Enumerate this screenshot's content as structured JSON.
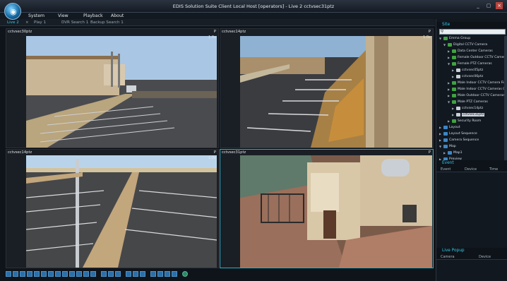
{
  "window": {
    "title": "EDIS Solution Suite Client Local Host [operators] - Live 2  cctvsec31ptz",
    "min_icon": "minimize-icon",
    "max_icon": "maximize-icon",
    "close_icon": "close-icon"
  },
  "menu": [
    "System",
    "View",
    "Playback",
    "About"
  ],
  "tabs": [
    {
      "label": "Live 2",
      "active": true
    },
    {
      "label": "Play 1",
      "active": false
    },
    {
      "label": "DVR Search 1",
      "active": false
    },
    {
      "label": "Backup Search 1",
      "active": false
    }
  ],
  "tab_close_glyph": "×",
  "panes": [
    {
      "label": "cctvsec30ptz",
      "flag": "P",
      "zoom": "1.0x",
      "selected": false
    },
    {
      "label": "cctvsec14ptz",
      "flag": "P",
      "zoom": "1.0x",
      "selected": false
    },
    {
      "label": "cctvsec14ptz",
      "flag": "P",
      "zoom": "1.0x",
      "selected": false
    },
    {
      "label": "cctvsec31ptz",
      "flag": "P",
      "zoom": "",
      "selected": true
    }
  ],
  "sidebar": {
    "site_header": "Site",
    "search_placeholder": "",
    "tree": [
      {
        "label": "Emma Group",
        "level": 0,
        "icon": "group-icon",
        "expanded": true
      },
      {
        "label": "Digital CCTV Camera",
        "level": 1,
        "icon": "folder-icon",
        "expanded": true
      },
      {
        "label": "Data Center Cameras",
        "level": 2,
        "icon": "folder-icon",
        "expanded": false
      },
      {
        "label": "Female Outdoor CCTV Cameras",
        "level": 2,
        "icon": "folder-icon",
        "expanded": false
      },
      {
        "label": "Female PTZ Cameras",
        "level": 2,
        "icon": "folder-icon",
        "expanded": true
      },
      {
        "label": "cctvsec05ptz",
        "level": 3,
        "icon": "camera-icon",
        "expanded": false
      },
      {
        "label": "cctvsec06ptz",
        "level": 3,
        "icon": "camera-icon",
        "expanded": false
      },
      {
        "label": "Male Indoor CCTV Camera First Floo",
        "level": 2,
        "icon": "folder-icon",
        "expanded": false
      },
      {
        "label": "Male Indoor CCTV Cameras Ground",
        "level": 2,
        "icon": "folder-icon",
        "expanded": false
      },
      {
        "label": "Male Outdoor CCTV Cameras",
        "level": 2,
        "icon": "folder-icon",
        "expanded": false
      },
      {
        "label": "Male PTZ Cameras",
        "level": 2,
        "icon": "folder-icon",
        "expanded": true
      },
      {
        "label": "cctvsec14ptz",
        "level": 3,
        "icon": "camera-icon",
        "expanded": false
      },
      {
        "label": "cctvsec31ptz",
        "level": 3,
        "icon": "camera-icon",
        "expanded": false,
        "selected": true
      },
      {
        "label": "Security Room",
        "level": 2,
        "icon": "folder-icon",
        "expanded": false
      },
      {
        "label": "Layout",
        "level": 0,
        "icon": "layout-icon",
        "expanded": false
      },
      {
        "label": "Layout Sequence",
        "level": 0,
        "icon": "layout-icon",
        "expanded": false
      },
      {
        "label": "Camera Sequence",
        "level": 0,
        "icon": "sequence-icon",
        "expanded": false
      },
      {
        "label": "Map",
        "level": 0,
        "icon": "map-icon",
        "expanded": true
      },
      {
        "label": "Map1",
        "level": 1,
        "icon": "map-icon",
        "expanded": false
      },
      {
        "label": "Preview",
        "level": 0,
        "icon": "preview-icon",
        "expanded": false
      }
    ],
    "event_header": "Event",
    "event_columns": [
      "Event",
      "Device",
      "Time"
    ],
    "popup_header": "Live Popup",
    "popup_columns": [
      "Camera",
      "Device"
    ]
  },
  "colors": {
    "accent": "#37c8e6",
    "folder_green": "#3fa33f",
    "camera_grey": "#c9cfd6"
  }
}
